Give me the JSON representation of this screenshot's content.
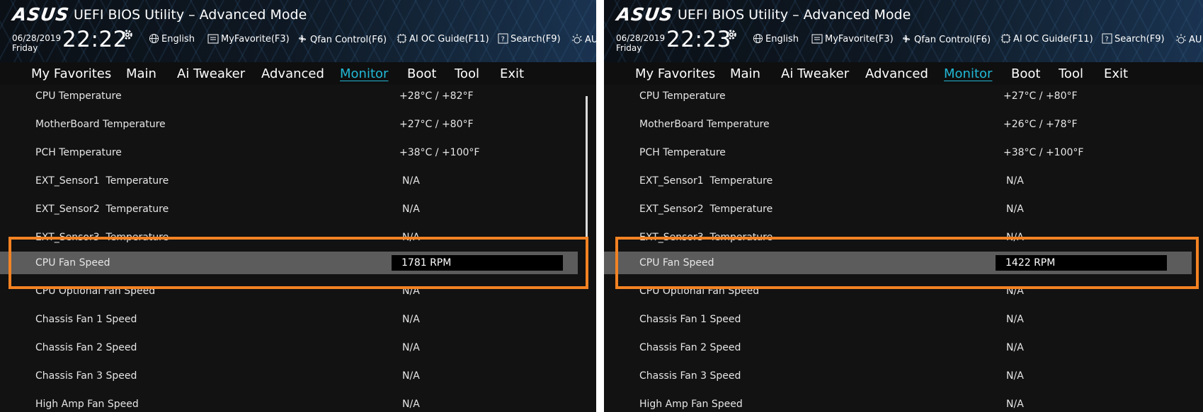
{
  "colors": {
    "accent": "#22b8d6",
    "highlight": "#f38222",
    "background": "#121212",
    "selected_row": "#5c5c5c"
  },
  "left": {
    "logo": "ASUS",
    "title": "UEFI BIOS Utility – Advanced Mode",
    "date": "06/28/2019",
    "day": "Friday",
    "time": "22:22",
    "toolbar": [
      {
        "label": "English",
        "icon": "globe-icon"
      },
      {
        "label": "MyFavorite(F3)",
        "icon": "favorite-icon"
      },
      {
        "label": "Qfan Control(F6)",
        "icon": "fan-icon"
      },
      {
        "label": "AI OC Guide(F11)",
        "icon": "ai-oc-icon"
      },
      {
        "label": "Search(F9)",
        "icon": "search-help-icon"
      },
      {
        "label": "AU",
        "icon": "aura-icon"
      }
    ],
    "tabs": [
      "My Favorites",
      "Main",
      "Ai Tweaker",
      "Advanced",
      "Monitor",
      "Boot",
      "Tool",
      "Exit"
    ],
    "active_tab": "Monitor",
    "rows": [
      {
        "label": "CPU Temperature",
        "value": "+28°C / +82°F"
      },
      {
        "label": "MotherBoard Temperature",
        "value": "+27°C / +80°F"
      },
      {
        "label": "PCH Temperature",
        "value": "+38°C / +100°F"
      },
      {
        "label": "EXT_Sensor1  Temperature",
        "value": "N/A"
      },
      {
        "label": "EXT_Sensor2  Temperature",
        "value": "N/A"
      },
      {
        "label": "EXT_Sensor3  Temperature",
        "value": "N/A"
      },
      {
        "label": "CPU Fan Speed",
        "value": "1781 RPM"
      },
      {
        "label": "CPU Optional Fan Speed",
        "value": "N/A"
      },
      {
        "label": "Chassis Fan 1 Speed",
        "value": "N/A"
      },
      {
        "label": "Chassis Fan 2 Speed",
        "value": "N/A"
      },
      {
        "label": "Chassis Fan 3 Speed",
        "value": "N/A"
      },
      {
        "label": "High Amp Fan Speed",
        "value": "N/A"
      }
    ]
  },
  "right": {
    "logo": "ASUS",
    "title": "UEFI BIOS Utility – Advanced Mode",
    "date": "06/28/2019",
    "day": "Friday",
    "time": "22:23",
    "toolbar": [
      {
        "label": "English",
        "icon": "globe-icon"
      },
      {
        "label": "MyFavorite(F3)",
        "icon": "favorite-icon"
      },
      {
        "label": "Qfan Control(F6)",
        "icon": "fan-icon"
      },
      {
        "label": "AI OC Guide(F11)",
        "icon": "ai-oc-icon"
      },
      {
        "label": "Search(F9)",
        "icon": "search-help-icon"
      },
      {
        "label": "AU",
        "icon": "aura-icon"
      }
    ],
    "tabs": [
      "My Favorites",
      "Main",
      "Ai Tweaker",
      "Advanced",
      "Monitor",
      "Boot",
      "Tool",
      "Exit"
    ],
    "active_tab": "Monitor",
    "rows": [
      {
        "label": "CPU Temperature",
        "value": "+27°C / +80°F"
      },
      {
        "label": "MotherBoard Temperature",
        "value": "+26°C / +78°F"
      },
      {
        "label": "PCH Temperature",
        "value": "+38°C / +100°F"
      },
      {
        "label": "EXT_Sensor1  Temperature",
        "value": "N/A"
      },
      {
        "label": "EXT_Sensor2  Temperature",
        "value": "N/A"
      },
      {
        "label": "EXT_Sensor3  Temperature",
        "value": "N/A"
      },
      {
        "label": "CPU Fan Speed",
        "value": "1422 RPM"
      },
      {
        "label": "CPU Optional Fan Speed",
        "value": "N/A"
      },
      {
        "label": "Chassis Fan 1 Speed",
        "value": "N/A"
      },
      {
        "label": "Chassis Fan 2 Speed",
        "value": "N/A"
      },
      {
        "label": "Chassis Fan 3 Speed",
        "value": "N/A"
      },
      {
        "label": "High Amp Fan Speed",
        "value": "N/A"
      }
    ]
  }
}
